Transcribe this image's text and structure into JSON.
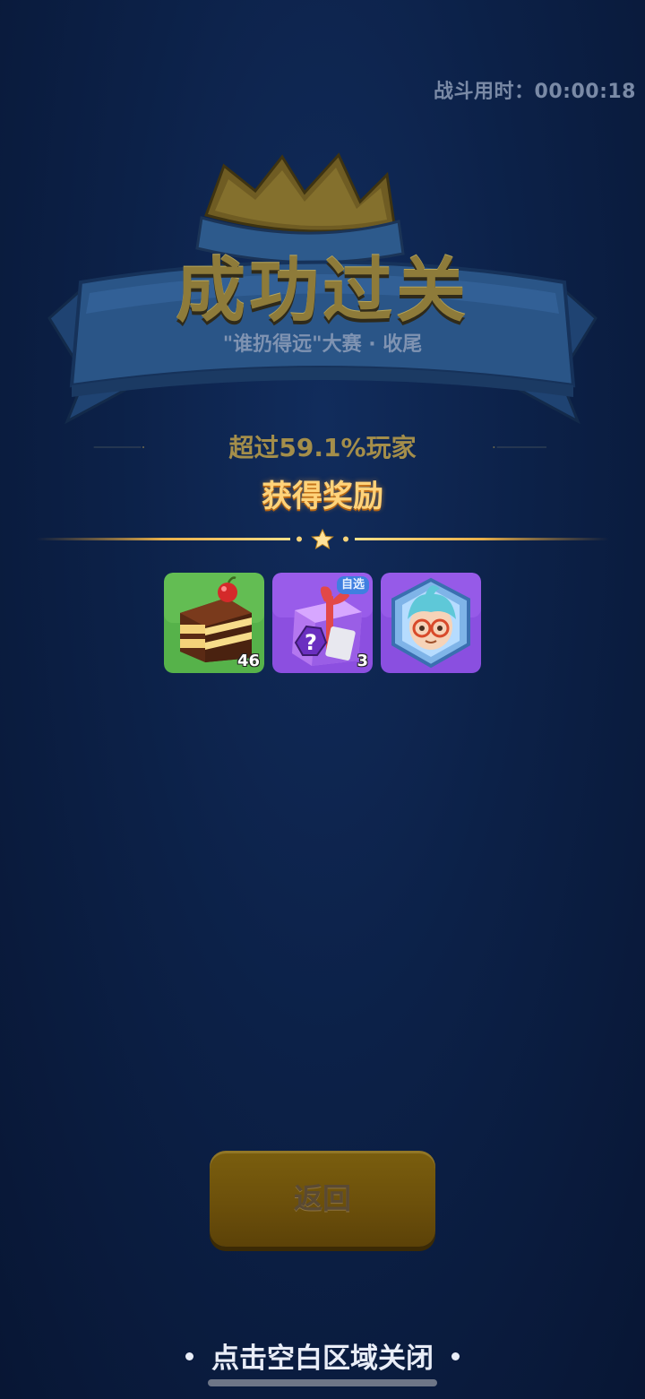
{
  "timer": {
    "label": "战斗用时：",
    "value": "00:00:18"
  },
  "result": {
    "title": "成功过关",
    "subtitle": "\"谁扔得远\"大赛 · 收尾"
  },
  "rank": {
    "prefix": "超过",
    "percent": "59.1%",
    "suffix": "玩家"
  },
  "rewards": {
    "title": "获得奖励",
    "items": [
      {
        "icon": "cake-icon",
        "count": "46"
      },
      {
        "icon": "mystery-gift-box-icon",
        "tag": "自选",
        "count": "3"
      },
      {
        "icon": "avatar-frame-icon"
      }
    ]
  },
  "buttons": {
    "back_label": "返回"
  },
  "close_hint": "点击空白区域关闭",
  "colors": {
    "background": "#0c2148",
    "title_gold": "#8e7b3a",
    "reward_title": "#ffd37a",
    "button_gold": "#6c500b",
    "cake_bg": "#56b24a",
    "purple_bg": "#8c4fe0"
  }
}
